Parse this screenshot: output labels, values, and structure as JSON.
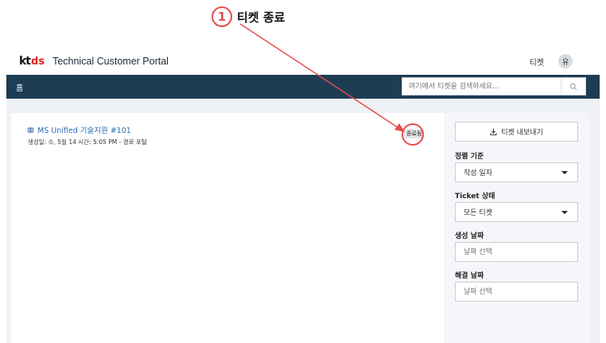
{
  "annotation": {
    "number": "1",
    "text": "티켓 종료"
  },
  "header": {
    "logo_kt": "kt",
    "logo_ds": "ds",
    "title": "Technical Customer Portal",
    "ticket_link": "티켓",
    "avatar_initial": "유"
  },
  "nav": {
    "home": "홈",
    "search_placeholder": "여기에서 티켓을 검색하세요..."
  },
  "tickets": [
    {
      "title": "MS Unified 기술지원 #101",
      "meta": "생성일: 수, 5월 14 시간: 5:05 PM - 경로 포털",
      "status": "종료됨"
    }
  ],
  "sidebar": {
    "export_label": "티켓 내보내기",
    "sort_label": "정렬 기준",
    "sort_value": "작성 일자",
    "status_label": "Ticket 상태",
    "status_value": "모든 티켓",
    "created_label": "생성 날짜",
    "created_placeholder": "날짜 선택",
    "resolved_label": "해결 날짜",
    "resolved_placeholder": "날짜 선택"
  },
  "colors": {
    "annotation": "#e74c4c",
    "navbar": "#1d3d55",
    "link": "#2b6cb0",
    "logo_ds": "#e2231a"
  },
  "icons": [
    "globe-icon",
    "download-icon",
    "search-icon",
    "chevron-down-icon"
  ]
}
